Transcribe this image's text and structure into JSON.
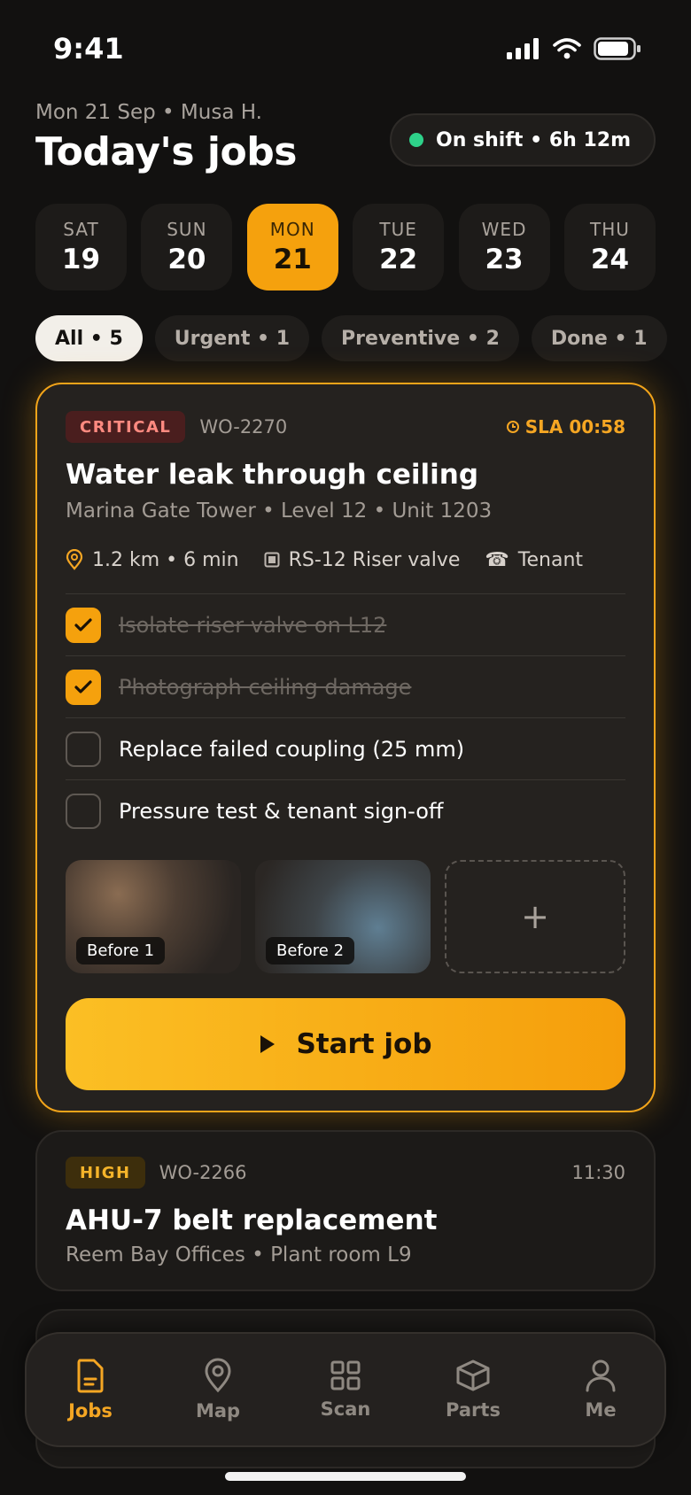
{
  "status_bar": {
    "time": "9:41"
  },
  "header": {
    "subtitle": "Mon 21 Sep • Musa H.",
    "title": "Today's jobs",
    "shift": "On shift • 6h 12m"
  },
  "days": [
    {
      "dow": "SAT",
      "num": "19"
    },
    {
      "dow": "SUN",
      "num": "20"
    },
    {
      "dow": "MON",
      "num": "21"
    },
    {
      "dow": "TUE",
      "num": "22"
    },
    {
      "dow": "WED",
      "num": "23"
    },
    {
      "dow": "THU",
      "num": "24"
    }
  ],
  "filters": [
    "All • 5",
    "Urgent • 1",
    "Preventive • 2",
    "Done • 1"
  ],
  "job_main": {
    "priority": "CRITICAL",
    "wo": "WO-2270",
    "sla": "SLA 00:58",
    "title": "Water leak through ceiling",
    "address": "Marina Gate Tower • Level 12 • Unit 1203",
    "distance": "1.2 km • 6 min",
    "asset": "RS-12 Riser valve",
    "contact": "Tenant",
    "checklist": [
      {
        "label": "Isolate riser valve on L12",
        "done": true
      },
      {
        "label": "Photograph ceiling damage",
        "done": true
      },
      {
        "label": "Replace failed coupling (25 mm)",
        "done": false
      },
      {
        "label": "Pressure test & tenant sign-off",
        "done": false
      }
    ],
    "photos": [
      "Before 1",
      "Before 2"
    ],
    "add_photo": "+",
    "start_label": "Start job"
  },
  "job_2": {
    "priority": "HIGH",
    "wo": "WO-2266",
    "time": "11:30",
    "title": "AHU-7 belt replacement",
    "address": "Reem Bay Offices • Plant room L9"
  },
  "tabs": [
    "Jobs",
    "Map",
    "Scan",
    "Parts",
    "Me"
  ],
  "colors": {
    "accent": "#f5a10d",
    "background": "#121110",
    "card": "#25221f",
    "critical": "#ff8a80",
    "shift_dot": "#2ed28a"
  }
}
